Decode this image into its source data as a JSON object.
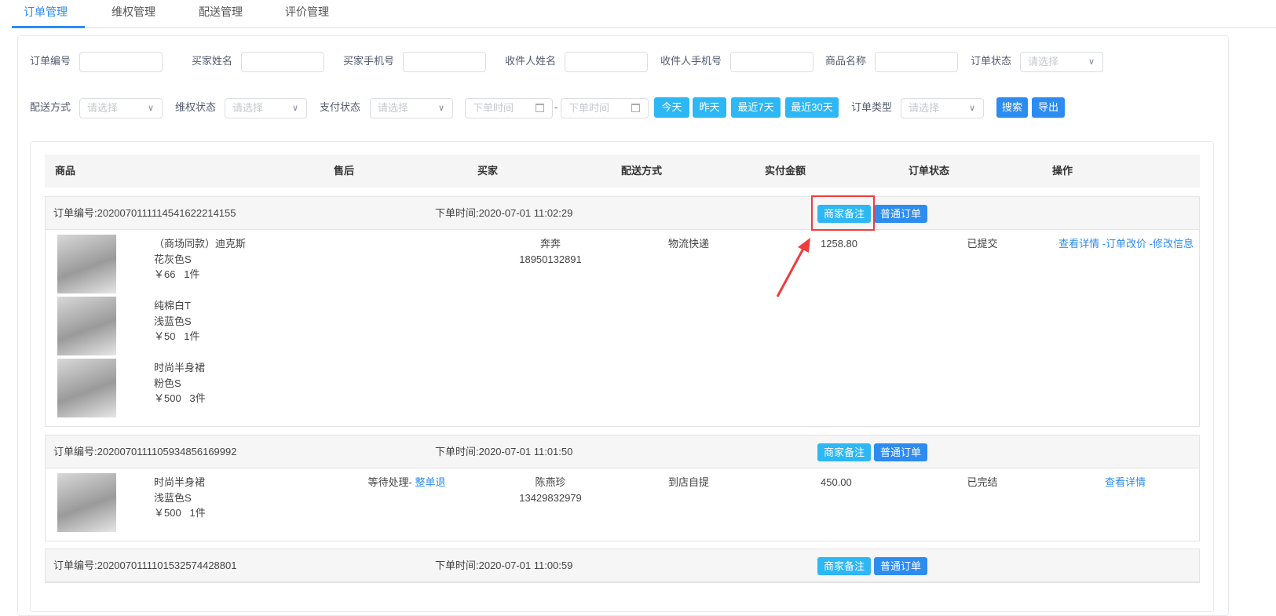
{
  "tabs": [
    "订单管理",
    "维权管理",
    "配送管理",
    "评价管理"
  ],
  "filters": {
    "order_no": "订单编号",
    "buyer_name": "买家姓名",
    "buyer_phone": "买家手机号",
    "receiver_name": "收件人姓名",
    "receiver_phone": "收件人手机号",
    "product_name": "商品名称",
    "order_status": "订单状态",
    "delivery": "配送方式",
    "rights_status": "维权状态",
    "pay_status": "支付状态",
    "order_type": "订单类型",
    "select_placeholder": "请选择",
    "date_placeholder": "下单时间",
    "date_sep": "-",
    "today": "今天",
    "yesterday": "昨天",
    "last7": "最近7天",
    "last30": "最近30天",
    "search": "搜索",
    "export": "导出"
  },
  "columns": [
    "商品",
    "售后",
    "买家",
    "配送方式",
    "实付金额",
    "订单状态",
    "操作"
  ],
  "orders": [
    {
      "no": "订单编号:2020070111114541622214155",
      "time": "下单时间:2020-07-01 11:02:29",
      "remark": "商家备注",
      "type": "普通订单",
      "items": [
        {
          "name": "（商场同款）迪克斯",
          "spec": "花灰色S",
          "price": "￥66   1件"
        },
        {
          "name": "纯棉白T",
          "spec": "浅蓝色S",
          "price": "￥50   1件"
        },
        {
          "name": "时尚半身裙",
          "spec": "粉色S",
          "price": "￥500   3件"
        }
      ],
      "aftersale": "",
      "aftersale_link": "",
      "buyer": "奔奔",
      "phone": "18950132891",
      "delivery": "物流快递",
      "amount": "1258.80",
      "status": "已提交",
      "actions": [
        "查看详情",
        " -订单改价",
        " -修改信息"
      ]
    },
    {
      "no": "订单编号:2020070111105934856169992",
      "time": "下单时间:2020-07-01 11:01:50",
      "remark": "商家备注",
      "type": "普通订单",
      "items": [
        {
          "name": "时尚半身裙",
          "spec": "浅蓝色S",
          "price": "￥500   1件"
        }
      ],
      "aftersale": "等待处理- ",
      "aftersale_link": "整单退",
      "buyer": "陈燕珍",
      "phone": "13429832979",
      "delivery": "到店自提",
      "amount": "450.00",
      "status": "已完结",
      "actions": [
        "查看详情"
      ]
    },
    {
      "no": "订单编号:2020070111101532574428801",
      "time": "下单时间:2020-07-01 11:00:59",
      "remark": "商家备注",
      "type": "普通订单",
      "items": []
    }
  ],
  "colors": {
    "primary": "#2d8cf0",
    "info": "#2db7f5",
    "highlight": "#f03c3c"
  }
}
